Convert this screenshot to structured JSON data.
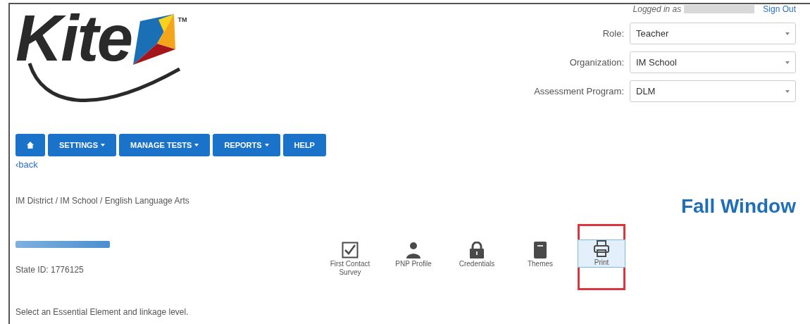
{
  "logo": {
    "wordmark": "Kite",
    "trademark": "TM"
  },
  "user_bar": {
    "logged_in_label": "Logged in as",
    "sign_out": "Sign Out"
  },
  "selectors": [
    {
      "label": "Role:",
      "value": "Teacher"
    },
    {
      "label": "Organization:",
      "value": "IM School"
    },
    {
      "label": "Assessment Program:",
      "value": "DLM"
    }
  ],
  "nav": [
    {
      "kind": "home"
    },
    {
      "kind": "menu",
      "label": "SETTINGS"
    },
    {
      "kind": "menu",
      "label": "MANAGE TESTS"
    },
    {
      "kind": "menu",
      "label": "REPORTS"
    },
    {
      "kind": "link",
      "label": "HELP"
    }
  ],
  "back_link": "‹back",
  "breadcrumb": "IM District / IM School / English Language Arts",
  "window_label": "Fall Window",
  "student": {
    "state_id": "State ID: 1776125"
  },
  "tools": [
    {
      "kind": "survey",
      "label": "First Contact Survey",
      "highlighted": false
    },
    {
      "kind": "profile",
      "label": "PNP Profile",
      "highlighted": false
    },
    {
      "kind": "credentials",
      "label": "Credentials",
      "highlighted": false
    },
    {
      "kind": "themes",
      "label": "Themes",
      "highlighted": false
    },
    {
      "kind": "print",
      "label": "Print",
      "highlighted": true
    }
  ],
  "instruction": "Select an Essential Element and linkage level."
}
